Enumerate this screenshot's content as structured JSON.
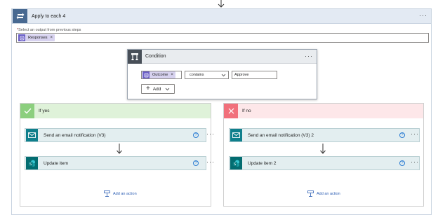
{
  "loop": {
    "title": "Apply to each 4",
    "select_label": "Select an output from previous steps",
    "required_mark": "*",
    "token": "Responses",
    "token_remove": "×",
    "more": "···"
  },
  "condition": {
    "title": "Condition",
    "more": "···",
    "left_token": "Outcome",
    "token_remove": "×",
    "operator": "contains",
    "value": "Approve",
    "add_label": "Add"
  },
  "branch_yes": {
    "title": "If yes",
    "actions": [
      {
        "title": "Send an email notification (V3)",
        "help": "?",
        "more": "···"
      },
      {
        "title": "Update item",
        "help": "?",
        "more": "···"
      }
    ],
    "add_action": "Add an action"
  },
  "branch_no": {
    "title": "If no",
    "actions": [
      {
        "title": "Send an email notification (V3) 2",
        "help": "?",
        "more": "···"
      },
      {
        "title": "Update item 2",
        "help": "?",
        "more": "···"
      }
    ],
    "add_action": "Add an action"
  },
  "colors": {
    "loop_accent": "#486991",
    "yes_accent": "#8ccf7e",
    "no_accent": "#f1707b",
    "email_icon": "#0f7f8c",
    "sharepoint_icon": "#036c70",
    "link": "#2b5db3"
  },
  "icons": {
    "loop": "loop-icon",
    "condition": "condition-icon",
    "check": "check-icon",
    "close": "close-icon",
    "email": "email-icon",
    "sharepoint": "sharepoint-icon",
    "token": "forms-icon",
    "add_action": "add-action-icon"
  }
}
